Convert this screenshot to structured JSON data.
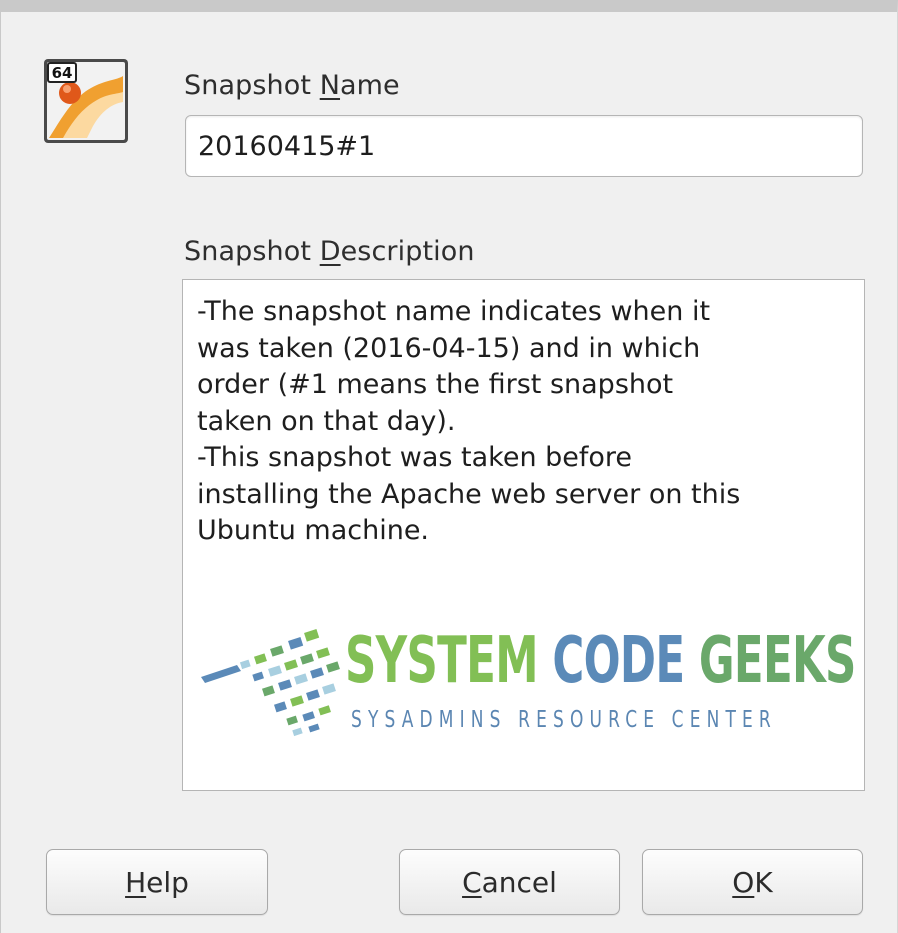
{
  "dialog": {
    "icon": "virtualbox-64-icon",
    "name_label": "Snapshot Name",
    "name_label_mnemonic": "N",
    "name_value": "20160415#1",
    "description_label": "Snapshot Description",
    "description_label_mnemonic": "D",
    "description_text": "-The snapshot name indicates when it\nwas taken (2016-04-15) and in which\norder (#1 means the first snapshot\ntaken on that day).\n-This snapshot was taken before\ninstalling the Apache web server on this\nUbuntu machine.",
    "icon_badge": "64"
  },
  "watermark": {
    "title_part1": "SYSTEM",
    "title_part2": "CODE",
    "title_part3": "GEEKS",
    "subtitle": "SYSADMINS RESOURCE CENTER",
    "colors": {
      "green": "#82bf55",
      "blue": "#5b8ab8",
      "darkgreen": "#6aa86a"
    }
  },
  "buttons": {
    "help": "Help",
    "cancel": "Cancel",
    "ok": "OK"
  }
}
